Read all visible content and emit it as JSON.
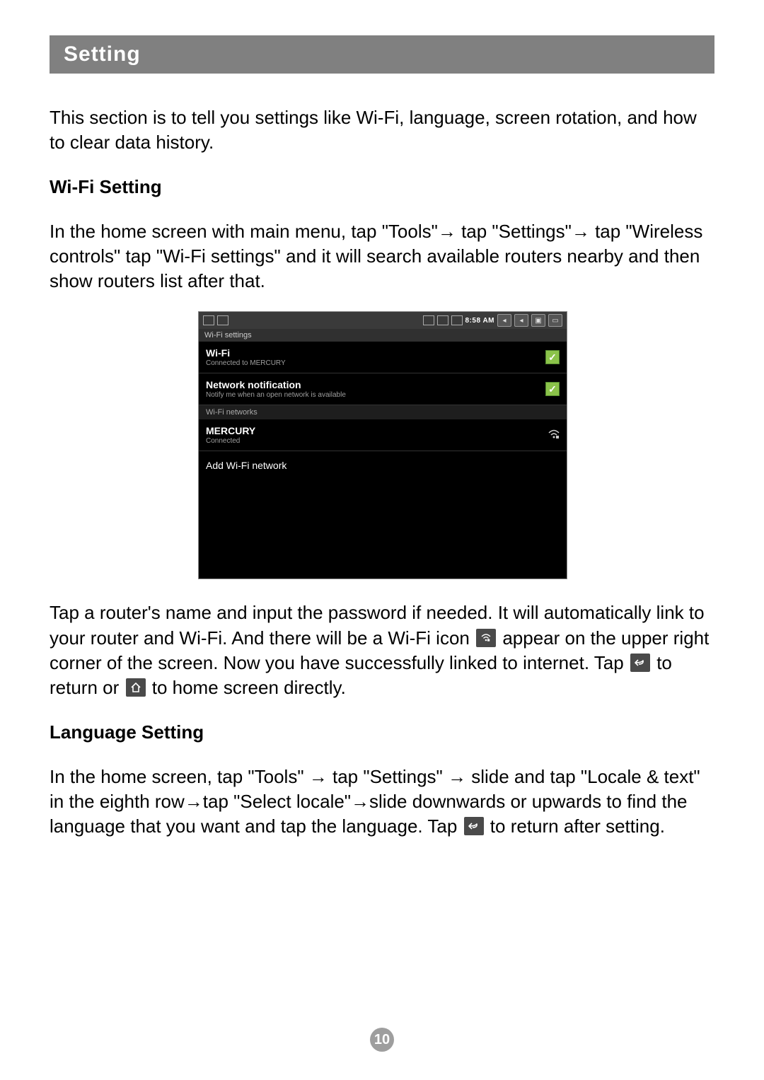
{
  "page": {
    "section_title": "Setting",
    "intro": "This section is to tell you settings like Wi-Fi, language, screen rotation, and how to clear data history.",
    "wifi_heading": "Wi-Fi Setting",
    "wifi_para1": "In the home screen with main menu, tap \"Tools\"→ tap \"Settings\"→ tap \"Wireless controls\" tap \"Wi-Fi settings\" and it will search available routers nearby and then show routers list after that.",
    "wifi_para2_a": "Tap a router's name and input the password if needed. It will automatically link to your router and Wi-Fi. And there will be a Wi-Fi icon ",
    "wifi_para2_b": " appear on the upper right corner of the screen. Now you have successfully linked to internet. Tap ",
    "wifi_para2_c": " to return or ",
    "wifi_para2_d": " to home screen directly.",
    "lang_heading": "Language Setting",
    "lang_para_a": "In the home screen, tap \"Tools\" → tap \"Settings\" → slide and tap \"Locale & text\" in the eighth row→tap \"Select locale\"→slide downwards or upwards to find the language that you want and tap the language. Tap ",
    "lang_para_b": " to return after setting.",
    "page_number": "10"
  },
  "screenshot": {
    "statusbar": {
      "time": "8:58 AM"
    },
    "header": "Wi-Fi settings",
    "rows": [
      {
        "title": "Wi-Fi",
        "sub": "Connected to MERCURY",
        "right": "check"
      },
      {
        "title": "Network notification",
        "sub": "Notify me when an open network is available",
        "right": "check"
      }
    ],
    "networks_label": "Wi-Fi networks",
    "network": {
      "title": "MERCURY",
      "sub": "Connected",
      "right": "wifi"
    },
    "add": "Add Wi-Fi network"
  },
  "icons": {
    "wifi_inline": "⧈",
    "back_inline": "↶",
    "home_inline": "⌂",
    "check": "✓",
    "wifi_signal": "⧉"
  }
}
